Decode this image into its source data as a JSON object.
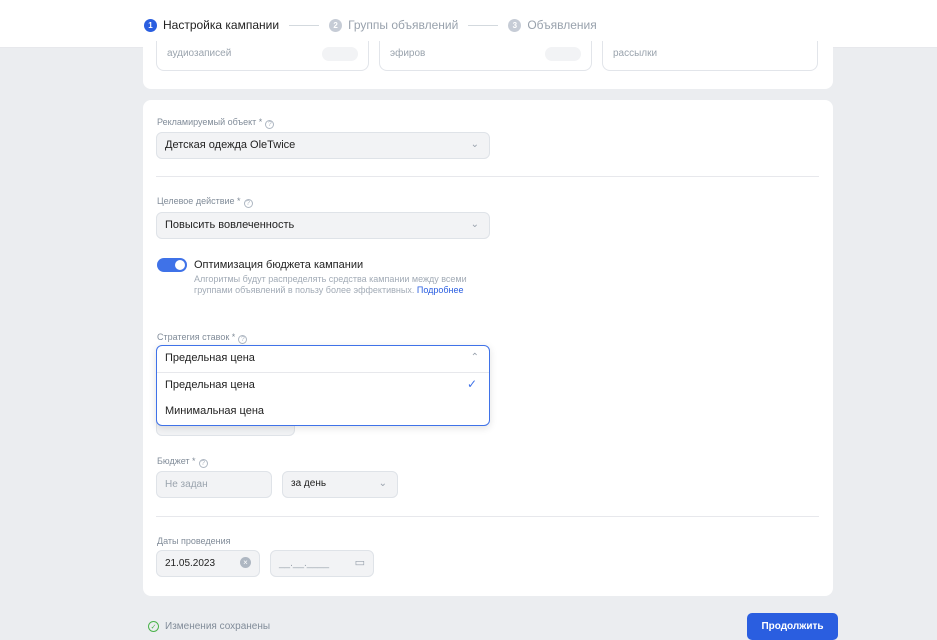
{
  "steps": [
    {
      "num": "1",
      "label": "Настройка кампании"
    },
    {
      "num": "2",
      "label": "Группы объявлений"
    },
    {
      "num": "3",
      "label": "Объявления"
    }
  ],
  "top_stats": [
    "аудиозаписей",
    "эфиров",
    "рассылки"
  ],
  "promoted": {
    "label": "Рекламируемый объект *",
    "value": "Детская одежда OleTwice"
  },
  "target": {
    "label": "Целевое действие *",
    "value": "Повысить вовлеченность"
  },
  "optimization": {
    "title": "Оптимизация бюджета кампании",
    "desc": "Алгоритмы будут распределять средства кампании между всеми группами объявлений в пользу более эффективных.",
    "link": "Подробнее",
    "enabled": true
  },
  "strategy": {
    "label": "Стратегия ставок *",
    "value": "Предельная цена",
    "options": [
      "Предельная цена",
      "Минимальная цена"
    ]
  },
  "budget": {
    "label": "Бюджет *",
    "placeholder": "Не задан",
    "period": "за день"
  },
  "dates": {
    "label": "Даты проведения",
    "start": "21.05.2023",
    "end_placeholder": "__.__.____"
  },
  "footer": {
    "status": "Изменения сохранены",
    "continue": "Продолжить"
  },
  "colors": {
    "accent": "#2a5ee0",
    "toggle": "#3f72e8",
    "success": "#4bb34b"
  }
}
